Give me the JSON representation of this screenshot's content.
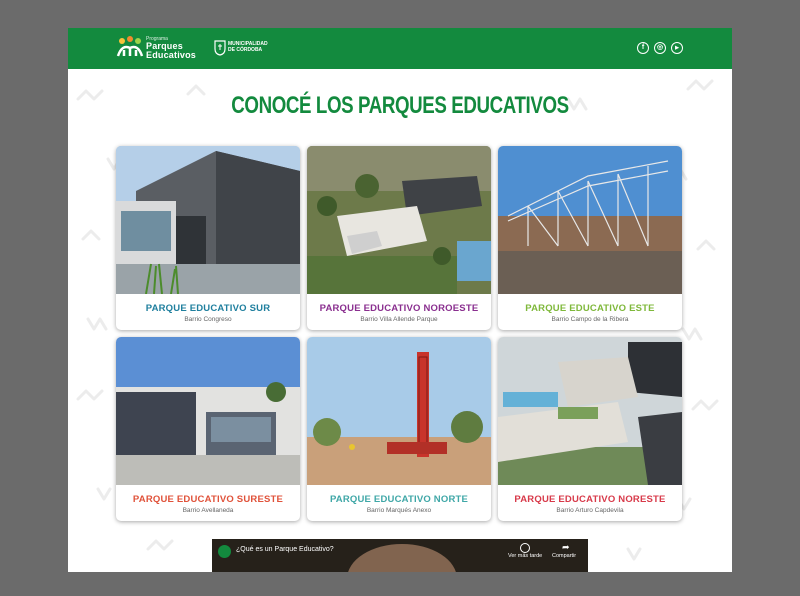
{
  "header": {
    "logo_small": "Programa",
    "logo_line1": "Parques",
    "logo_line2": "Educativos",
    "muni_line1": "MUNICIPALIDAD",
    "muni_line2": "DE CÓRDOBA",
    "social": [
      {
        "icon": "facebook-icon",
        "glyph": "f"
      },
      {
        "icon": "instagram-icon",
        "glyph": "◎"
      },
      {
        "icon": "youtube-icon",
        "glyph": "▶"
      }
    ]
  },
  "heading": "CONOCÉ LOS PARQUES EDUCATIVOS",
  "cards": [
    {
      "title": "PARQUE EDUCATIVO SUR",
      "subtitle": "Barrio Congreso",
      "color": "#1f7f9e"
    },
    {
      "title": "PARQUE EDUCATIVO NOROESTE",
      "subtitle": "Barrio Villa Allende Parque",
      "color": "#8a2f8f"
    },
    {
      "title": "PARQUE EDUCATIVO ESTE",
      "subtitle": "Barrio Campo de la Ribera",
      "color": "#7fb83b"
    },
    {
      "title": "PARQUE EDUCATIVO SURESTE",
      "subtitle": "Barrio Avellaneda",
      "color": "#e0523a"
    },
    {
      "title": "PARQUE EDUCATIVO NORTE",
      "subtitle": "Barrio Marqués Anexo",
      "color": "#3fa7a7"
    },
    {
      "title": "PARQUE EDUCATIVO NORESTE",
      "subtitle": "Barrio Arturo Capdevila",
      "color": "#d83a4a"
    }
  ],
  "video": {
    "title": "¿Qué es un Parque Educativo?",
    "watch_later": "Ver más tarde",
    "share": "Compartir"
  }
}
